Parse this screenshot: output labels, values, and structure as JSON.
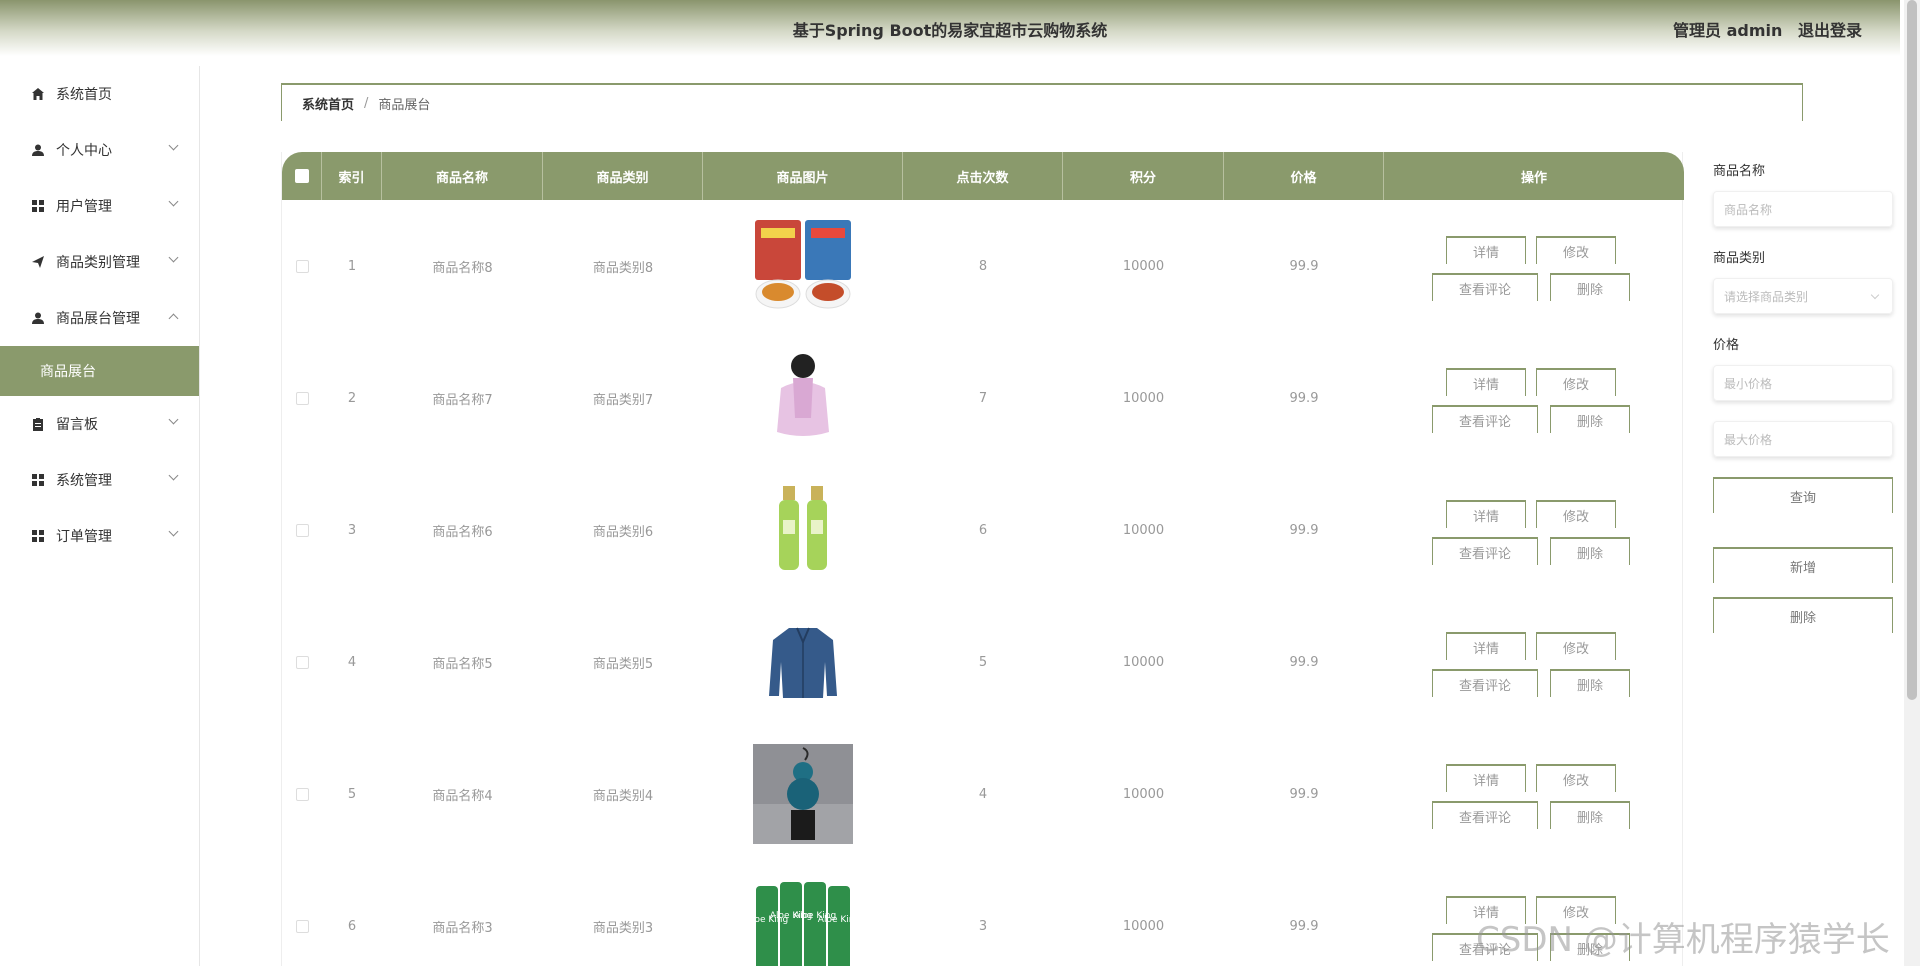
{
  "header": {
    "title": "基于Spring Boot的易家宜超市云购物系统",
    "user_label": "管理员 admin",
    "logout": "退出登录"
  },
  "sidebar": {
    "items": [
      {
        "label": "系统首页",
        "icon": "home-icon",
        "chevron": false
      },
      {
        "label": "个人中心",
        "icon": "user-icon",
        "chevron": true
      },
      {
        "label": "用户管理",
        "icon": "grid-icon",
        "chevron": true
      },
      {
        "label": "商品类别管理",
        "icon": "send-icon",
        "chevron": true
      },
      {
        "label": "商品展台管理",
        "icon": "user-icon",
        "chevron": true,
        "expanded": true
      },
      {
        "label": "留言板",
        "icon": "clipboard-icon",
        "chevron": true
      },
      {
        "label": "系统管理",
        "icon": "grid-icon",
        "chevron": true
      },
      {
        "label": "订单管理",
        "icon": "grid-icon",
        "chevron": true
      }
    ],
    "active_sub": "商品展台"
  },
  "breadcrumb": {
    "home": "系统首页",
    "sep": "/",
    "current": "商品展台"
  },
  "table": {
    "headers": [
      "索引",
      "商品名称",
      "商品类别",
      "商品图片",
      "点击次数",
      "积分",
      "价格",
      "操作"
    ],
    "rows": [
      {
        "index": "1",
        "name": "商品名称8",
        "category": "商品类别8",
        "image": "snack-bag-image",
        "clicks": "8",
        "points": "10000",
        "price": "99.9"
      },
      {
        "index": "2",
        "name": "商品名称7",
        "category": "商品类别7",
        "image": "pink-jacket-image",
        "clicks": "7",
        "points": "10000",
        "price": "99.9"
      },
      {
        "index": "3",
        "name": "商品名称6",
        "category": "商品类别6",
        "image": "green-bottles-image",
        "clicks": "6",
        "points": "10000",
        "price": "99.9"
      },
      {
        "index": "4",
        "name": "商品名称5",
        "category": "商品类别5",
        "image": "denim-jacket-image",
        "clicks": "5",
        "points": "10000",
        "price": "99.9"
      },
      {
        "index": "5",
        "name": "商品名称4",
        "category": "商品类别4",
        "image": "gourd-ornament-image",
        "clicks": "4",
        "points": "10000",
        "price": "99.9"
      },
      {
        "index": "6",
        "name": "商品名称3",
        "category": "商品类别3",
        "image": "aloe-drinks-image",
        "clicks": "3",
        "points": "10000",
        "price": "99.9"
      }
    ],
    "actions": {
      "detail": "详情",
      "edit": "修改",
      "comments": "查看评论",
      "delete": "删除"
    },
    "image_text": {
      "aloe": "Aloe King"
    }
  },
  "search": {
    "name_label": "商品名称",
    "name_placeholder": "商品名称",
    "category_label": "商品类别",
    "category_placeholder": "请选择商品类别",
    "price_label": "价格",
    "min_placeholder": "最小价格",
    "max_placeholder": "最大价格",
    "query": "查询",
    "add": "新增",
    "delete": "删除"
  },
  "watermark": "CSDN @计算机程序猿学长",
  "colors": {
    "accent": "#8a9a6c"
  }
}
